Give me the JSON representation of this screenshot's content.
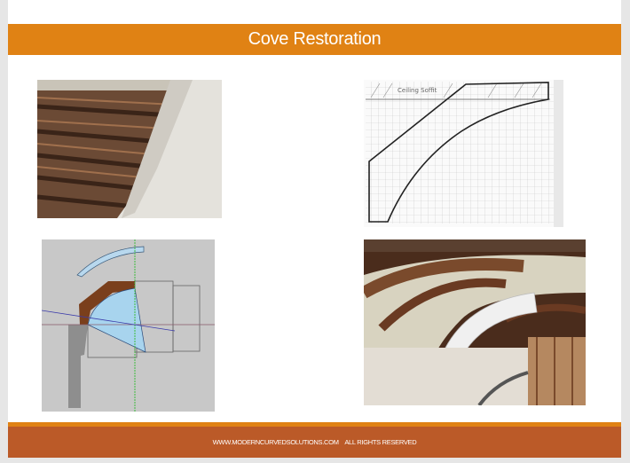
{
  "header": {
    "title": "Cove Restoration"
  },
  "images": [
    {
      "name": "ceiling-beams-photo"
    },
    {
      "name": "cove-profile-sketch",
      "label": "Ceiling Soffit"
    },
    {
      "name": "cove-cad-drawing"
    },
    {
      "name": "cove-installed-photo"
    }
  ],
  "footer": {
    "text": "WWW.MODERNCURVEDSOLUTIONS.COM    ALL RIGHTS RESERVED"
  },
  "colors": {
    "accent": "#e08214",
    "footer": "#bb5a28"
  }
}
